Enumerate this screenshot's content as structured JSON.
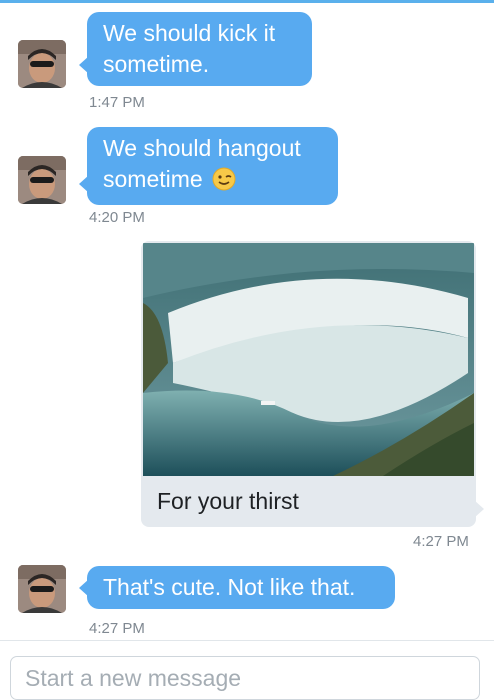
{
  "messages": [
    {
      "from": "them",
      "text": "We should kick it sometime.",
      "time": "1:47 PM"
    },
    {
      "from": "them",
      "text": "We should hangout sometime",
      "emoji": "winking-face",
      "time": "4:20 PM"
    },
    {
      "from": "me",
      "type": "photo",
      "image": "waterfall-photo",
      "caption": "For your thirst",
      "time": "4:27 PM"
    },
    {
      "from": "them",
      "text": "That's cute. Not like that.",
      "time": "4:27 PM"
    }
  ],
  "composer": {
    "placeholder": "Start a new message"
  },
  "colors": {
    "incoming_bubble": "#58aaf0",
    "outgoing_card": "#e4e9ee",
    "timestamp": "#7f8891",
    "accent": "#5ab0ec"
  }
}
